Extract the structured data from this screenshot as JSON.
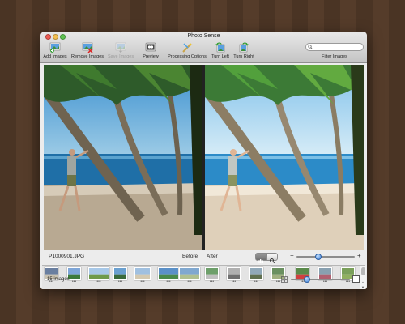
{
  "window": {
    "title": "Photo Sense",
    "traffic_lights": [
      "#ee5b52",
      "#f4be4f",
      "#5fc452"
    ]
  },
  "toolbar": {
    "items": [
      {
        "label": "Add Images",
        "icon": "add-images-icon",
        "enabled": true
      },
      {
        "label": "Remove Images",
        "icon": "remove-images-icon",
        "enabled": true
      },
      {
        "label": "Save Images",
        "icon": "save-images-icon",
        "enabled": false
      },
      {
        "label": "Preview",
        "icon": "preview-icon",
        "enabled": true
      },
      {
        "label": "Processing Options",
        "icon": "processing-options-icon",
        "enabled": true
      },
      {
        "label": "Turn Left",
        "icon": "turn-left-icon",
        "enabled": true
      },
      {
        "label": "Turn Right",
        "icon": "turn-right-icon",
        "enabled": true
      }
    ],
    "search": {
      "value": "",
      "placeholder": "",
      "label": "Filter Images"
    }
  },
  "preview": {
    "filename": "P1000901.JPG",
    "before_label": "Before",
    "after_label": "After",
    "tools": [
      "pan-hand-icon",
      "magnifier-icon"
    ],
    "zoom_level": 0.35
  },
  "filmstrip": {
    "thumbnail_count": 14,
    "selected_index": 0
  },
  "footer": {
    "image_count": "15 images",
    "thumbnail_size": 0.25
  },
  "colors": {
    "accent": "#3a7ed8",
    "desktop": "#4a3424"
  }
}
